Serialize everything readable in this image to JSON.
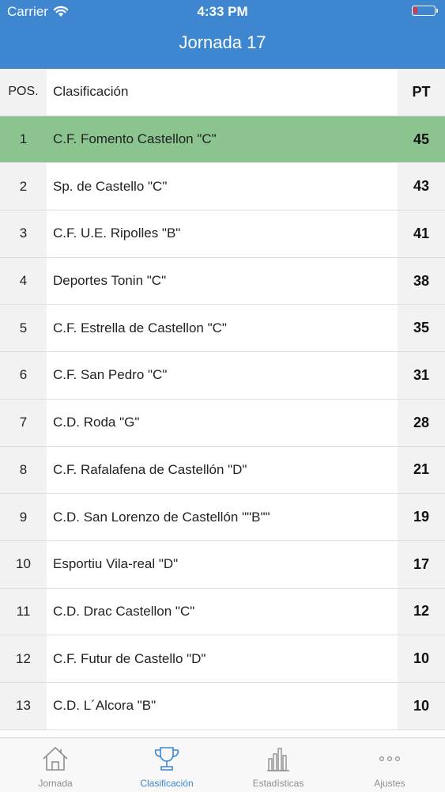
{
  "status_bar": {
    "carrier": "Carrier",
    "time": "4:33 PM"
  },
  "header": {
    "title": "Jornada 17"
  },
  "table": {
    "columns": {
      "pos": "POS.",
      "name": "Clasificación",
      "pt": "PT"
    },
    "rows": [
      {
        "pos": "1",
        "name": "C.F. Fomento Castellon \"C\"",
        "pt": "45"
      },
      {
        "pos": "2",
        "name": "Sp. de Castello \"C\"",
        "pt": "43"
      },
      {
        "pos": "3",
        "name": "C.F. U.E. Ripolles \"B\"",
        "pt": "41"
      },
      {
        "pos": "4",
        "name": "Deportes Tonin \"C\"",
        "pt": "38"
      },
      {
        "pos": "5",
        "name": "C.F. Estrella de Castellon \"C\"",
        "pt": "35"
      },
      {
        "pos": "6",
        "name": "C.F. San Pedro \"C\"",
        "pt": "31"
      },
      {
        "pos": "7",
        "name": "C.D. Roda \"G\"",
        "pt": "28"
      },
      {
        "pos": "8",
        "name": "C.F. Rafalafena de Castellón \"D\"",
        "pt": "21"
      },
      {
        "pos": "9",
        "name": "C.D. San Lorenzo de Castellón \"\"B\"\"",
        "pt": "19"
      },
      {
        "pos": "10",
        "name": "Esportiu Vila-real \"D\"",
        "pt": "17"
      },
      {
        "pos": "11",
        "name": "C.D. Drac Castellon \"C\"",
        "pt": "12"
      },
      {
        "pos": "12",
        "name": "C.F. Futur de Castello \"D\"",
        "pt": "10"
      },
      {
        "pos": "13",
        "name": "C.D. L´Alcora \"B\"",
        "pt": "10"
      }
    ]
  },
  "tabbar": {
    "items": [
      {
        "label": "Jornada",
        "icon": "home-icon"
      },
      {
        "label": "Clasificación",
        "icon": "trophy-icon"
      },
      {
        "label": "Estadísticas",
        "icon": "bar-chart-icon"
      },
      {
        "label": "Ajustes",
        "icon": "more-icon"
      }
    ],
    "active": "Clasificación"
  },
  "colors": {
    "header": "#3e86cf",
    "highlight_row": "#8bc48f",
    "accent": "#3e86cf"
  }
}
